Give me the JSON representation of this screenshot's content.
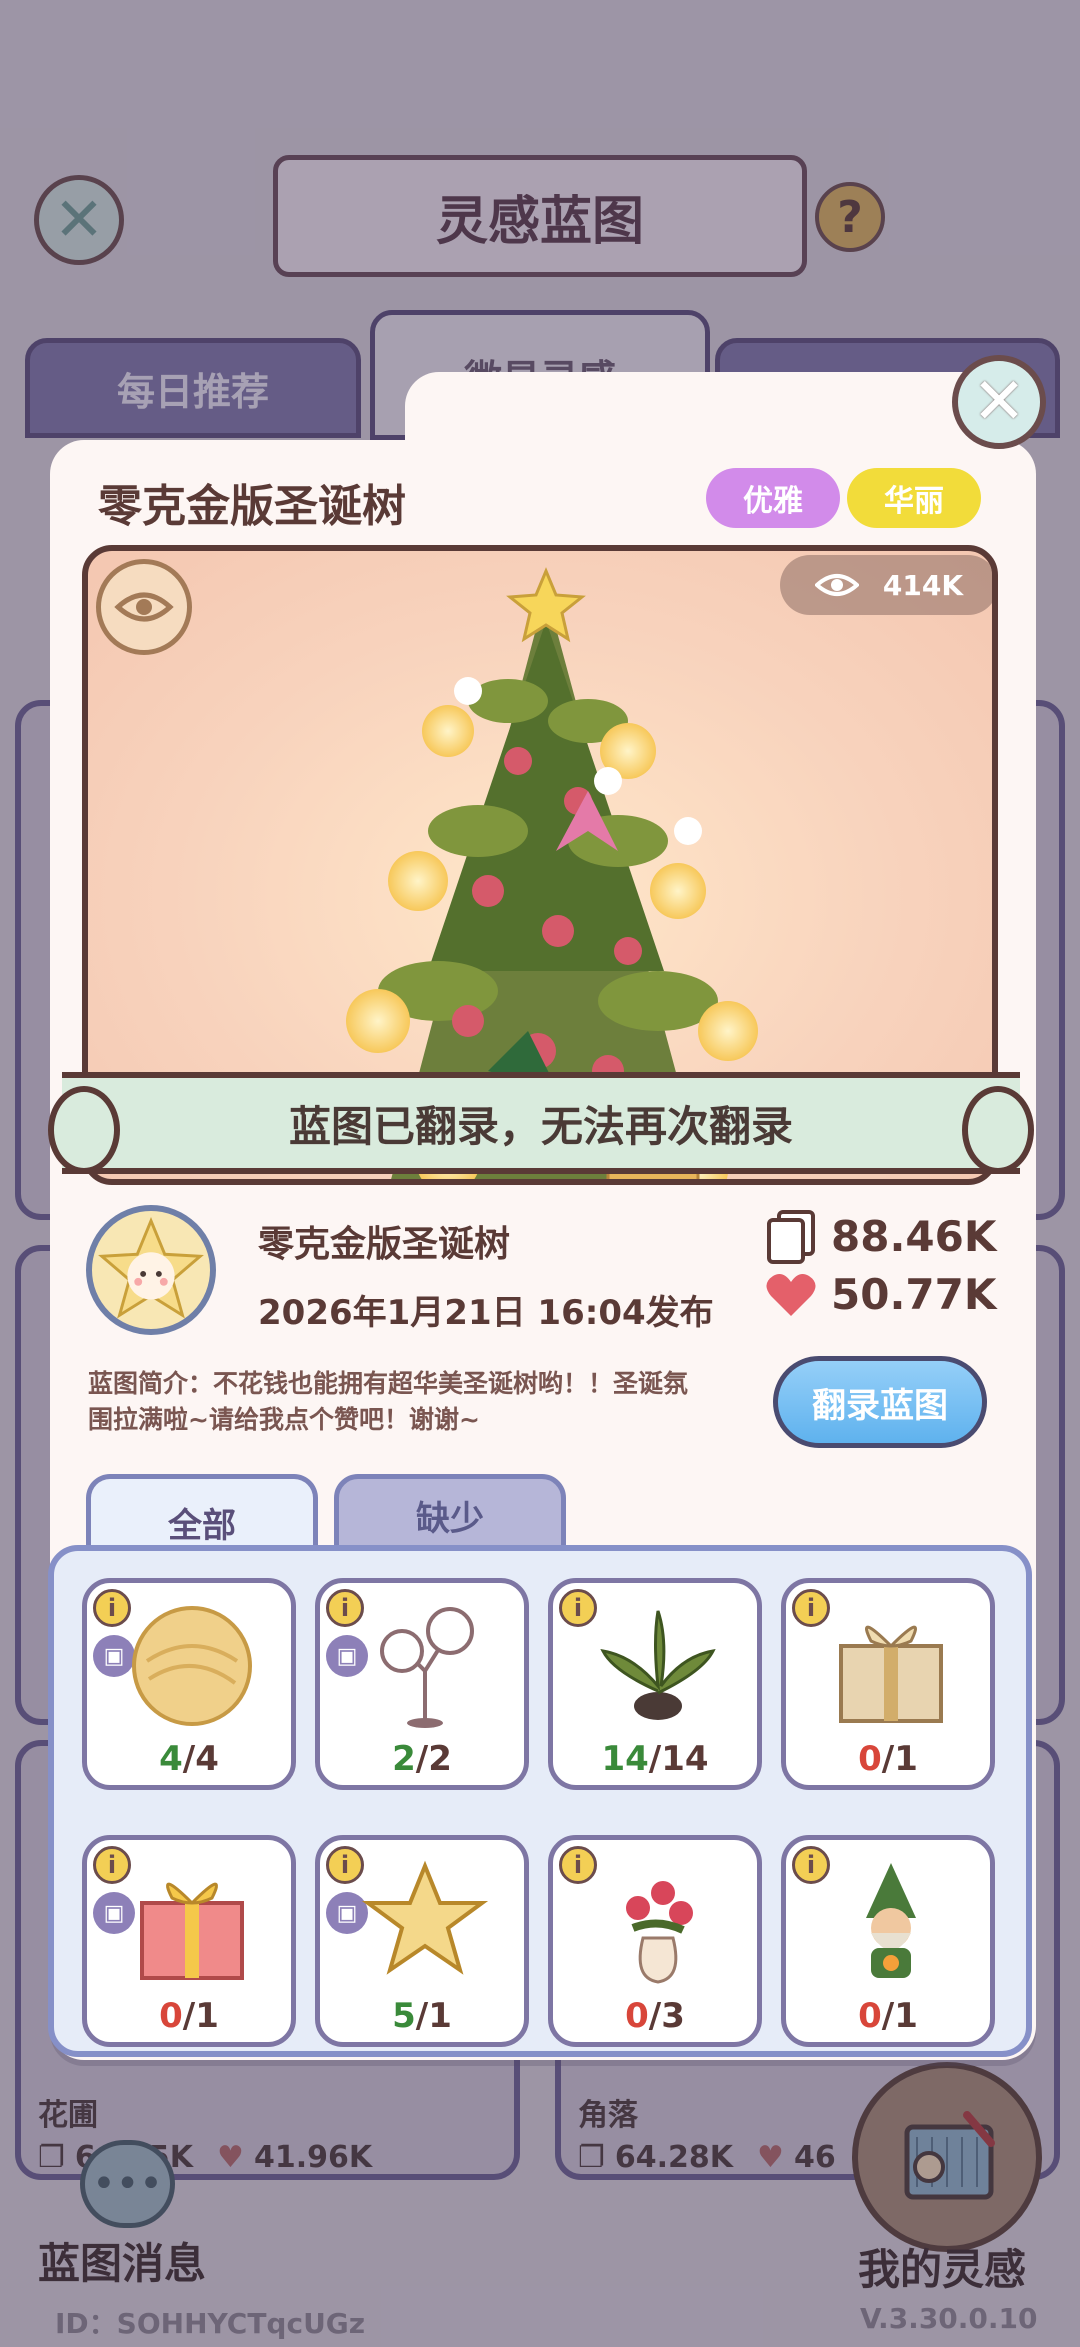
{
  "background": {
    "title": "灵感蓝图",
    "tabs": [
      "每日推荐",
      "微星灵感",
      ""
    ],
    "cards": [
      {
        "label": "花圃",
        "copies": "64.45K",
        "likes": "41.96K"
      },
      {
        "label": "角落",
        "copies": "64.28K",
        "likes": "46"
      }
    ],
    "messages_label": "蓝图消息",
    "my_inspiration_label": "我的灵感",
    "user_id": "ID：SOHHYCTqcUGz",
    "version": "V.3.30.0.10"
  },
  "modal": {
    "title": "零克金版圣诞树",
    "tags": [
      "优雅",
      "华丽"
    ],
    "views": "414K",
    "banner": "蓝图已翻录，无法再次翻录",
    "author_name": "零克金版圣诞树",
    "publish_date": "2026年1月21日 16:04发布",
    "copies": "88.46K",
    "likes": "50.77K",
    "description": "蓝图简介：不花钱也能拥有超华美圣诞树哟！！圣诞氛围拉满啦~请给我点个赞吧！谢谢~",
    "copy_button": "翻录蓝图",
    "tab_all": "全部",
    "tab_missing": "缺少",
    "items": [
      {
        "name": "gold-ball",
        "have": "4",
        "need": "/4",
        "ok": true,
        "icon": "gold-orb"
      },
      {
        "name": "balloon-lamp",
        "have": "2",
        "need": "/2",
        "ok": true,
        "icon": "balloon-lamp"
      },
      {
        "name": "potted-plant",
        "have": "14",
        "need": "/14",
        "ok": true,
        "icon": "leafy-plant"
      },
      {
        "name": "beige-gift",
        "have": "0",
        "need": "/1",
        "ok": false,
        "icon": "gift-box"
      },
      {
        "name": "red-gift",
        "have": "0",
        "need": "/1",
        "ok": false,
        "icon": "red-gift-box"
      },
      {
        "name": "gold-star",
        "have": "5",
        "need": "/1",
        "ok": true,
        "icon": "star"
      },
      {
        "name": "rose-vase",
        "have": "0",
        "need": "/3",
        "ok": false,
        "icon": "rose-vase"
      },
      {
        "name": "gnome",
        "have": "0",
        "need": "/1",
        "ok": false,
        "icon": "gnome"
      }
    ]
  },
  "colors": {
    "accent_blue": "#5fb2ee",
    "ok_green": "#3a8a3a",
    "missing_red": "#d8463a",
    "tag_purple": "#d28bea",
    "tag_yellow": "#f2dc3a"
  }
}
